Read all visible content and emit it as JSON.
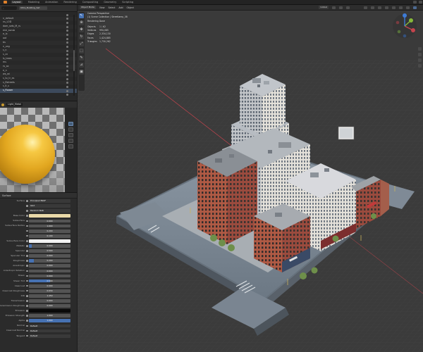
{
  "topbar": {
    "workspaces": [
      "Layout",
      "Modeling",
      "Animation",
      "Rendering",
      "Compositing",
      "Geometry",
      "Scripting"
    ],
    "active_index": 0
  },
  "outliner": {
    "search_placeholder": "",
    "selected_object": "Ultra_Building_Set",
    "rows": [
      "",
      "n_default",
      "ns_LOD",
      "dom_sets_M_rs",
      "ene_ssnsb",
      "e_lx",
      "oot",
      "bs",
      "n_ceg",
      "s_n",
      "s_cn",
      "ls_trees",
      "ms",
      "rs_ac",
      "e_n",
      "ws_wi",
      "s_to_tr_es",
      "s_flstreets",
      "s_lt_s",
      "s_Flower",
      ""
    ],
    "highlight_row": 19
  },
  "material": {
    "name": "Light_Metal",
    "section_title": "Surface",
    "properties": [
      {
        "label": "Surface",
        "value": "Principled BSDF",
        "kind": "dark"
      },
      {
        "label": "",
        "value": "GGX",
        "kind": "dark"
      },
      {
        "label": "",
        "value": "Random Walk",
        "kind": "dark"
      },
      {
        "label": "Base Color",
        "value": "",
        "kind": "tan"
      },
      {
        "label": "Subsurface",
        "value": "0.000",
        "kind": "num",
        "fill": 0
      },
      {
        "label": "Subsurface Radius",
        "value": "1.000",
        "kind": "num",
        "fill": 0
      },
      {
        "label": "",
        "value": "0.200",
        "kind": "num",
        "fill": 0
      },
      {
        "label": "",
        "value": "0.100",
        "kind": "num",
        "fill": 0
      },
      {
        "label": "Subsurface Color",
        "value": "",
        "kind": "white"
      },
      {
        "label": "Metallic",
        "value": "0.000",
        "kind": "num",
        "fill": 0.06
      },
      {
        "label": "Specular",
        "value": "0.500",
        "kind": "num",
        "fill": 0
      },
      {
        "label": "Specular Tint",
        "value": "0.000",
        "kind": "num",
        "fill": 0
      },
      {
        "label": "Roughness",
        "value": "0.200",
        "kind": "num",
        "fill": 0.12
      },
      {
        "label": "Anisotropic",
        "value": "0.000",
        "kind": "num",
        "fill": 0
      },
      {
        "label": "Anisotropic Rotation",
        "value": "0.000",
        "kind": "num",
        "fill": 0
      },
      {
        "label": "Sheen",
        "value": "0.000",
        "kind": "num",
        "fill": 0
      },
      {
        "label": "Sheen Tint",
        "value": "0.500",
        "kind": "num",
        "fill": 0.5
      },
      {
        "label": "Clearcoat",
        "value": "0.000",
        "kind": "num",
        "fill": 0
      },
      {
        "label": "Clearcoat Roughness",
        "value": "0.030",
        "kind": "num",
        "fill": 0
      },
      {
        "label": "IOR",
        "value": "1.450",
        "kind": "num",
        "fill": 0
      },
      {
        "label": "Transmission",
        "value": "0.000",
        "kind": "num",
        "fill": 0
      },
      {
        "label": "Transmission Roughness",
        "value": "0.000",
        "kind": "num",
        "fill": 0
      },
      {
        "label": "Emission",
        "value": "",
        "kind": "black"
      },
      {
        "label": "Emission Strength",
        "value": "1.000",
        "kind": "num",
        "fill": 0
      },
      {
        "label": "Alpha",
        "value": "1.000",
        "kind": "num",
        "fill": 1
      },
      {
        "label": "Normal",
        "value": "Default",
        "kind": "dark"
      },
      {
        "label": "Clearcoat Normal",
        "value": "Default",
        "kind": "dark"
      },
      {
        "label": "Tangent",
        "value": "Default",
        "kind": "dark"
      }
    ]
  },
  "viewport": {
    "mode": "Object Mode",
    "menus": [
      "View",
      "Select",
      "Add",
      "Object"
    ],
    "orientation": "Global",
    "info_title": "Camera Perspective",
    "info_sub": "(1) Scene Collection | Streetlamp_08",
    "info_render": "Rendering Done",
    "stats": [
      {
        "k": "Objects",
        "v": "1 / 62"
      },
      {
        "k": "Vertices",
        "v": "994,085"
      },
      {
        "k": "Edges",
        "v": "2,334,130"
      },
      {
        "k": "Faces",
        "v": "1,424,885"
      },
      {
        "k": "Triangles",
        "v": "1,730,262"
      }
    ]
  },
  "colors": {
    "accent": "#4772b3",
    "x_axis": "#c4444d",
    "y_axis": "#86b83a",
    "z_axis": "#3e7bd6"
  }
}
